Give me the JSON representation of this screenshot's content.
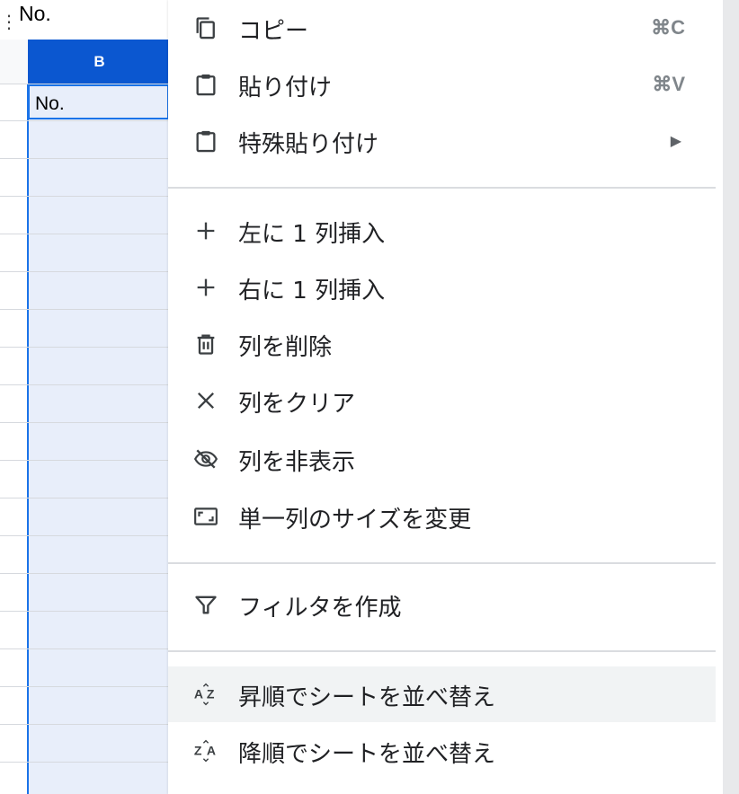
{
  "formula_bar": {
    "value": "No."
  },
  "grid": {
    "column_b_header": "B",
    "active_cell_value": "No."
  },
  "menu": {
    "copy": {
      "label": "コピー",
      "shortcut": "⌘C",
      "icon": "copy-icon"
    },
    "paste": {
      "label": "貼り付け",
      "shortcut": "⌘V",
      "icon": "clipboard-icon"
    },
    "paste_special": {
      "label": "特殊貼り付け",
      "icon": "clipboard-icon",
      "submenu": "▶"
    },
    "insert_left": {
      "label": "左に 1 列挿入",
      "icon": "plus-icon"
    },
    "insert_right": {
      "label": "右に 1 列挿入",
      "icon": "plus-icon"
    },
    "delete_column": {
      "label": "列を削除",
      "icon": "trash-icon"
    },
    "clear_column": {
      "label": "列をクリア",
      "icon": "close-icon"
    },
    "hide_column": {
      "label": "列を非表示",
      "icon": "eye-off-icon"
    },
    "resize_column": {
      "label": "単一列のサイズを変更",
      "icon": "resize-icon"
    },
    "create_filter": {
      "label": "フィルタを作成",
      "icon": "filter-icon"
    },
    "sort_asc": {
      "label": "昇順でシートを並べ替え",
      "icon": "sort-az-icon"
    },
    "sort_desc": {
      "label": "降順でシートを並べ替え",
      "icon": "sort-za-icon"
    }
  },
  "colors": {
    "header_selected": "#0b57d0",
    "selection_fill": "#e8eefa",
    "menu_hover": "#f1f3f4"
  }
}
